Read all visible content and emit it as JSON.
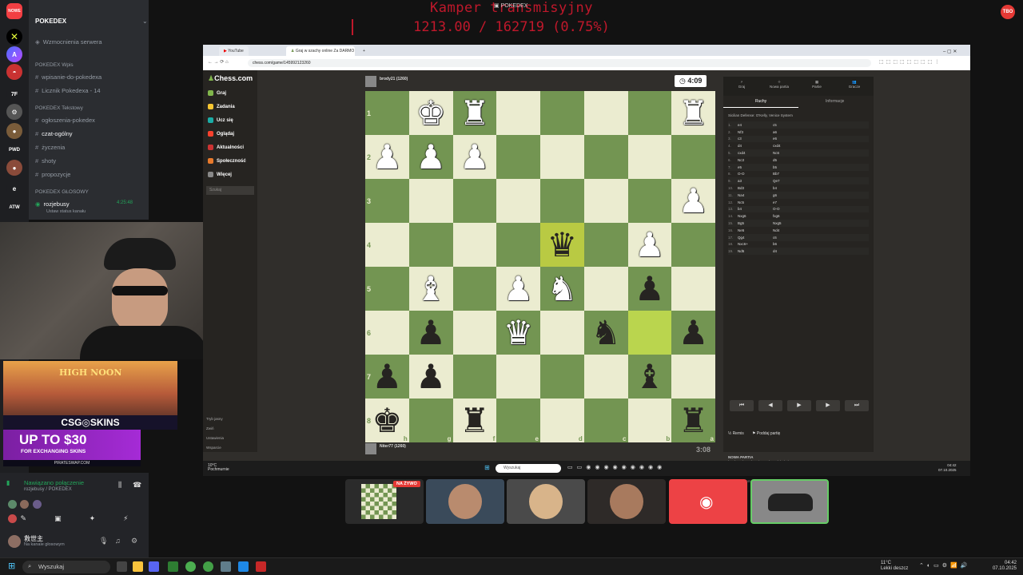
{
  "overlay": {
    "line1": "Kamper transmisyjny",
    "line2": "1213.00 / 162719 (0.75%)"
  },
  "window_title": "POKEDEX",
  "discord": {
    "server_name": "POKEDEX",
    "boost": "Wzmocnienia serwera",
    "categories": [
      "POKEDEX Wpis",
      "POKEDEX Tekstowy",
      "POKEDEX GŁOSOWY"
    ],
    "channels_wpis": [
      "wpisanie-do-pokedexa",
      "Licznik Pokedexa - 14"
    ],
    "channels_text": [
      "ogłoszenia-pokedex",
      "czat-ogólny",
      "życzenia",
      "shoty",
      "propozycje"
    ],
    "voice_channel": "rozjebusy",
    "voice_status": "Ustaw status kanału",
    "voice_time": "4:25:48",
    "rail_badge_new": "NOWE",
    "rail_labels": [
      "PWD",
      "e",
      "ATW"
    ],
    "voice_connected": "Nawiązano połączenie",
    "voice_sub": "rozjebusy / POKEDEX",
    "user_name": "救世主",
    "user_status": "Na kanale głosowym"
  },
  "ad": {
    "title": "HIGH NOON",
    "brand": "CSG◎SKINS",
    "offer": "UP TO $30",
    "offer_sub": "FOR EXCHANGING SKINS",
    "footer": "PIRATESWAP.COM"
  },
  "browser": {
    "tabs": [
      "YouTube",
      "Graj w szachy online Za DARMO"
    ],
    "url": "chess.com/game/145992123260"
  },
  "chess_nav": {
    "logo": "Chess.com",
    "items": [
      "Graj",
      "Zadania",
      "Ucz się",
      "Oglądaj",
      "Aktualności",
      "Społeczność",
      "Więcej"
    ],
    "search_placeholder": "Szukaj",
    "bottom": [
      "Tryb jasny",
      "Zwiń",
      "Ustawienia",
      "Wsparcie"
    ]
  },
  "game": {
    "top_player": "brody21 (1260)",
    "bottom_player": "Niter77 (1260)",
    "top_clock": "4:09",
    "bottom_clock": "3:08",
    "ranks": [
      "1",
      "2",
      "3",
      "4",
      "5",
      "6",
      "7",
      "8"
    ],
    "files": [
      "h",
      "g",
      "f",
      "e",
      "d",
      "c",
      "b",
      "a"
    ]
  },
  "panel": {
    "tabs": [
      "Graj",
      "Nowa partia",
      "Partie",
      "Gracze"
    ],
    "subtabs": [
      "Ruchy",
      "Informacje"
    ],
    "opening": "Sicilian Defense: O'Kelly, Venice System",
    "moves": [
      [
        "1.",
        "e4",
        "c5"
      ],
      [
        "2.",
        "Nf3",
        "a6"
      ],
      [
        "3.",
        "c3",
        "e6"
      ],
      [
        "4.",
        "d4",
        "cxd4"
      ],
      [
        "5.",
        "cxd4",
        "Nc6"
      ],
      [
        "6.",
        "Nc3",
        "d5"
      ],
      [
        "7.",
        "e5",
        "b5"
      ],
      [
        "8.",
        "O-O",
        "Bb7"
      ],
      [
        "9.",
        "a3",
        "Qe7"
      ],
      [
        "10.",
        "Bd3",
        "b4"
      ],
      [
        "11.",
        "Na4",
        "g6"
      ],
      [
        "12.",
        "Nc5",
        "e7"
      ],
      [
        "13.",
        "b4",
        "O-O"
      ],
      [
        "14.",
        "Nxg6",
        "fxg6"
      ],
      [
        "15.",
        "Bg5",
        "Nxg5"
      ],
      [
        "16.",
        "Ne5",
        "Nd4"
      ],
      [
        "17.",
        "Qg4",
        "c6"
      ],
      [
        "18.",
        "Nxc6+",
        "b6"
      ],
      [
        "19.",
        "Nd5",
        "d4"
      ]
    ],
    "controls": [
      "⏮",
      "◀",
      "▶",
      "▶",
      "⏭"
    ],
    "remis": "Remis",
    "resign": "Poddaj partię",
    "game_title": "NOWA PARTIA",
    "game_line1": "brody21 (1260) - Niter77 (1260) (5 | 5)",
    "game_line2": "wygrana +8 / remis +0 / przegrana -8",
    "chat_placeholder": "Wyślij wiadomość..."
  },
  "inner_taskbar": {
    "search": "Wyszukaj",
    "weather": "10°C",
    "weather_sub": "Pochmurnie",
    "time": "04:42",
    "date": "07.10.2025"
  },
  "thumbs": {
    "live_badge": "NA ŻYWO"
  },
  "taskbar": {
    "search": "Wyszukaj",
    "weather_temp": "11°C",
    "weather_desc": "Lekki deszcz",
    "time": "04:42",
    "date": "07.10.2025"
  }
}
